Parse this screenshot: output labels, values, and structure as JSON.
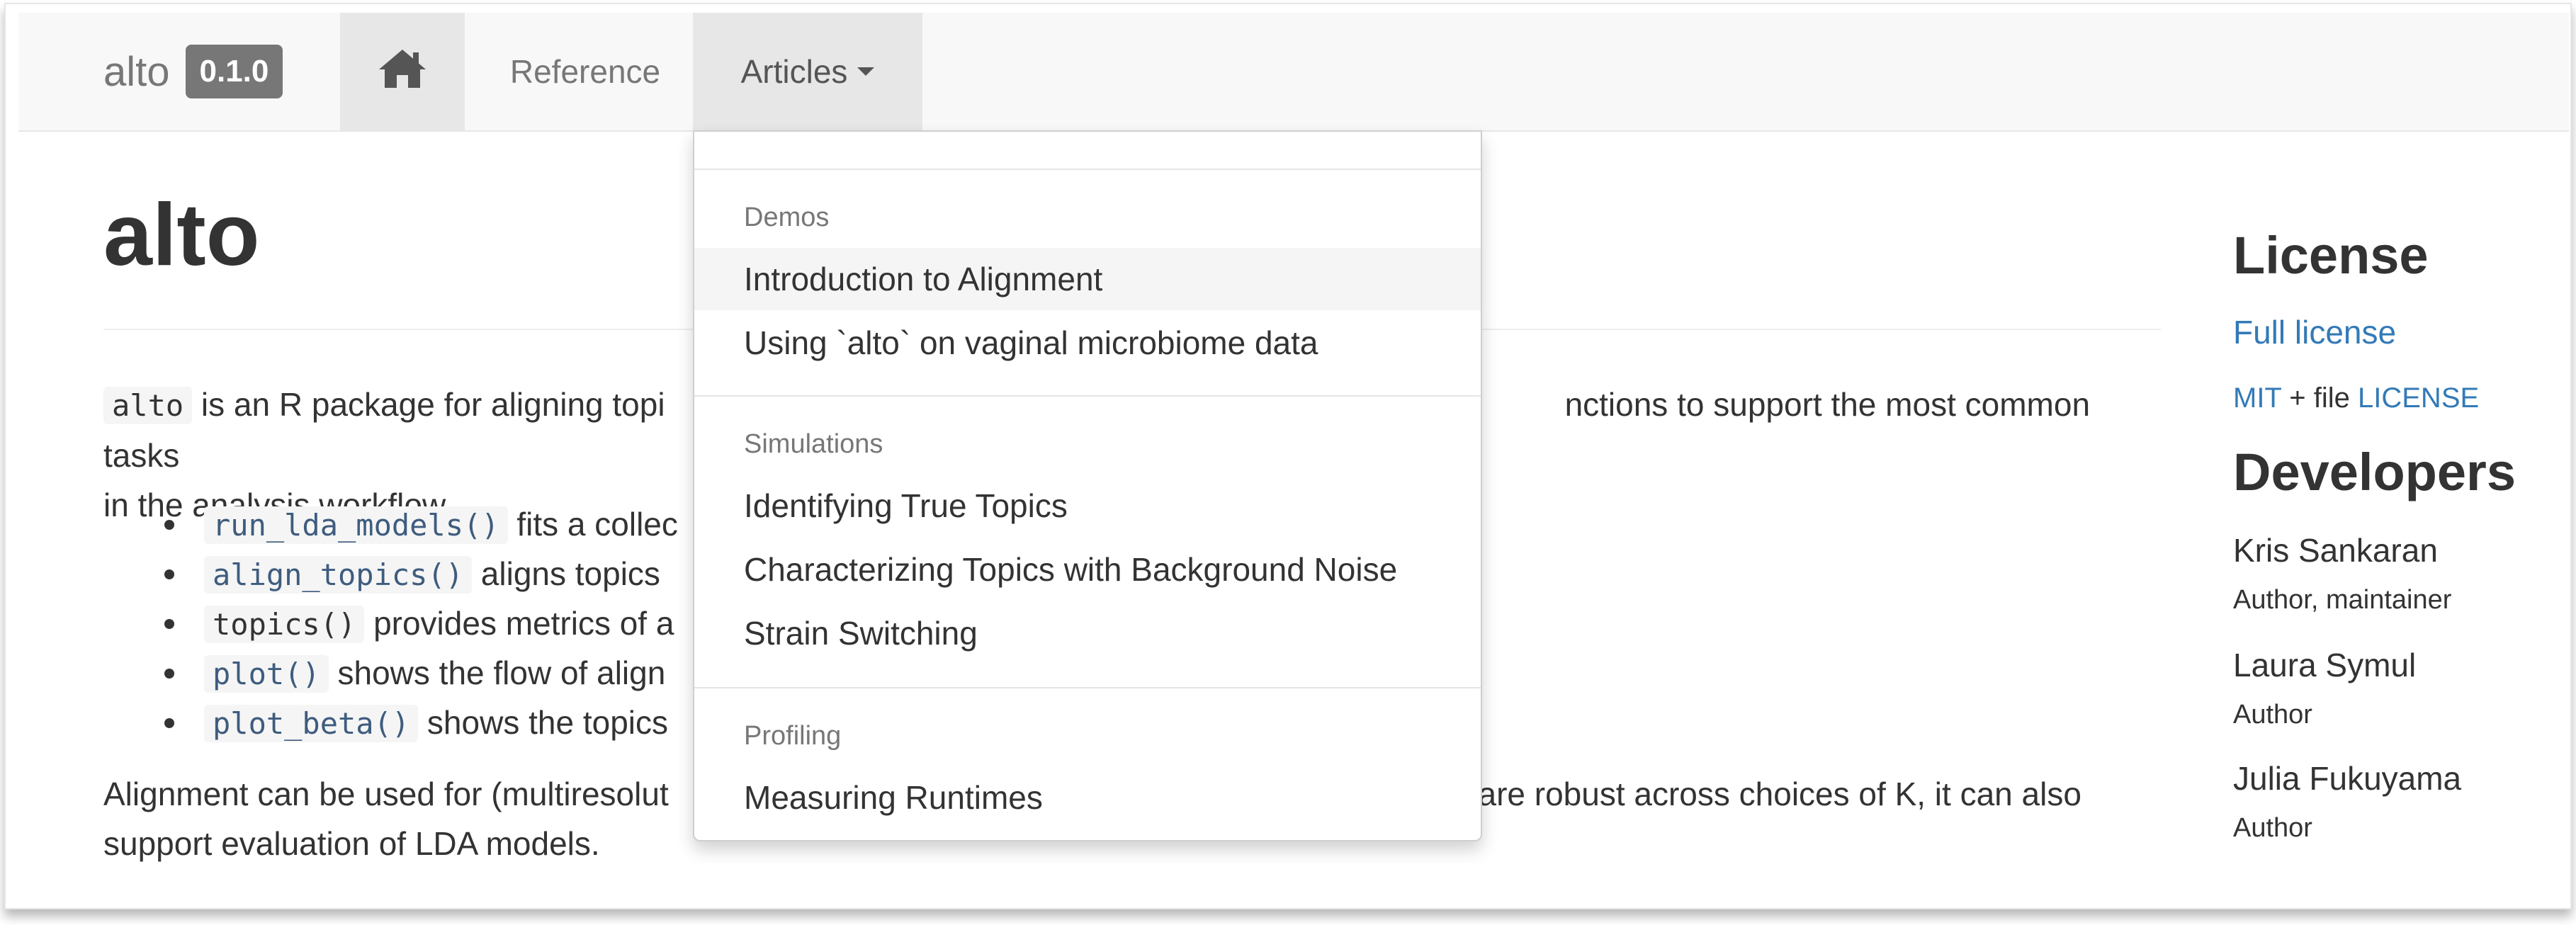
{
  "navbar": {
    "brand": "alto",
    "version": "0.1.0",
    "home_icon": "home-icon",
    "reference": "Reference",
    "articles": "Articles"
  },
  "main": {
    "title": "alto",
    "intro_code": "alto",
    "intro_visible_start": " is an R package for aligning topi",
    "intro_visible_end": "nctions to support the most common tasks",
    "intro_line2": "in the analysis workflow,",
    "bullets": [
      {
        "code": "run_lda_models()",
        "text": " fits a collec"
      },
      {
        "code": "align_topics()",
        "text": " aligns topics "
      },
      {
        "code": "topics()",
        "text": " provides metrics of a"
      },
      {
        "code": "plot()",
        "text": " shows the flow of align"
      },
      {
        "code": "plot_beta()",
        "text": " shows the topics"
      }
    ],
    "para2_start": "Alignment can be used for (multiresolut",
    "para2_end": " are robust across choices of K, it can also",
    "para2_line2": "support evaluation of LDA models."
  },
  "sidebar": {
    "license_heading": "License",
    "full_license": "Full license",
    "mit": "MIT",
    "plus_file": " + file ",
    "license_file": "LICENSE",
    "developers_heading": "Developers",
    "developers": [
      {
        "name": "Kris Sankaran",
        "role": "Author, maintainer"
      },
      {
        "name": "Laura Symul",
        "role": "Author"
      },
      {
        "name": "Julia Fukuyama",
        "role": "Author"
      }
    ]
  },
  "dropdown": {
    "groups": [
      {
        "header": "Demos",
        "items": [
          "Introduction to Alignment",
          "Using `alto` on vaginal microbiome data"
        ]
      },
      {
        "header": "Simulations",
        "items": [
          "Identifying True Topics",
          "Characterizing Topics with Background Noise",
          "Strain Switching"
        ]
      },
      {
        "header": "Profiling",
        "items": [
          "Measuring Runtimes"
        ]
      }
    ],
    "active_item": "Introduction to Alignment"
  }
}
